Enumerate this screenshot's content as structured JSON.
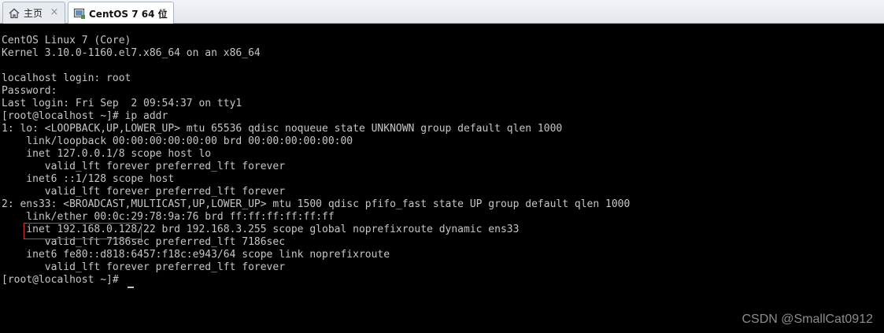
{
  "tabs": [
    {
      "label": "主页",
      "icon": "home-icon"
    },
    {
      "label": "CentOS 7 64 位",
      "icon": "vm-icon"
    }
  ],
  "close_glyph": "×",
  "terminal": {
    "lines": [
      "CentOS Linux 7 (Core)",
      "Kernel 3.10.0-1160.el7.x86_64 on an x86_64",
      "",
      "localhost login: root",
      "Password:",
      "Last login: Fri Sep  2 09:54:37 on tty1",
      "[root@localhost ~]# ip addr",
      "1: lo: <LOOPBACK,UP,LOWER_UP> mtu 65536 qdisc noqueue state UNKNOWN group default qlen 1000",
      "    link/loopback 00:00:00:00:00:00 brd 00:00:00:00:00:00",
      "    inet 127.0.0.1/8 scope host lo",
      "       valid_lft forever preferred_lft forever",
      "    inet6 ::1/128 scope host",
      "       valid_lft forever preferred_lft forever",
      "2: ens33: <BROADCAST,MULTICAST,UP,LOWER_UP> mtu 1500 qdisc pfifo_fast state UP group default qlen 1000",
      "    link/ether 00:0c:29:78:9a:76 brd ff:ff:ff:ff:ff:ff",
      "    inet 192.168.0.128/22 brd 192.168.3.255 scope global noprefixroute dynamic ens33",
      "       valid_lft 7186sec preferred_lft 7186sec",
      "    inet6 fe80::d818:6457:f18c:e943/64 scope link noprefixroute",
      "       valid_lft forever preferred_lft forever",
      "[root@localhost ~]# "
    ]
  },
  "watermark": "CSDN @SmallCat0912",
  "colors": {
    "terminal_bg": "#000000",
    "terminal_text": "#c6c6c6",
    "highlight_border": "#d83a3a",
    "active_tab_bg": "#ffffff"
  }
}
